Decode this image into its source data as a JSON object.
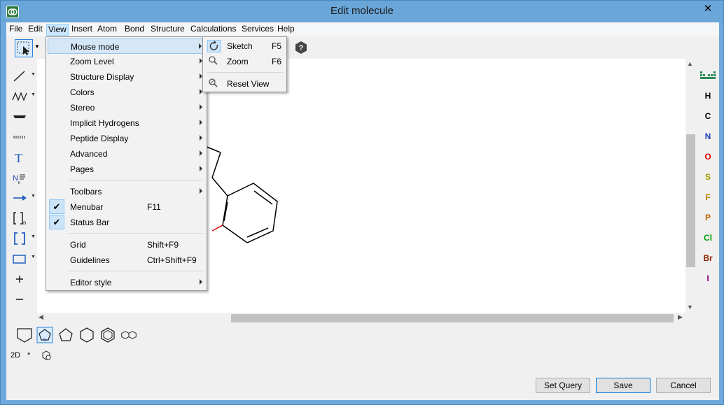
{
  "window": {
    "title": "Edit molecule",
    "close_glyph": "✕"
  },
  "menubar": [
    "File",
    "Edit",
    "View",
    "Insert",
    "Atom",
    "Bond",
    "Structure",
    "Calculations",
    "Services",
    "Help"
  ],
  "view_menu": {
    "items": [
      {
        "label": "Mouse mode",
        "submenu": true,
        "highlighted": true
      },
      {
        "label": "Zoom Level",
        "submenu": true
      },
      {
        "label": "Structure Display",
        "submenu": true
      },
      {
        "label": "Colors",
        "submenu": true
      },
      {
        "label": "Stereo",
        "submenu": true
      },
      {
        "label": "Implicit Hydrogens",
        "submenu": true
      },
      {
        "label": "Peptide Display",
        "submenu": true
      },
      {
        "label": "Advanced",
        "submenu": true
      },
      {
        "label": "Pages",
        "submenu": true
      },
      {
        "label": "Toolbars",
        "submenu": true
      },
      {
        "label": "Menubar",
        "shortcut": "F11",
        "checked": true
      },
      {
        "label": "Status Bar",
        "checked": true
      },
      {
        "label": "Grid",
        "shortcut": "Shift+F9"
      },
      {
        "label": "Guidelines",
        "shortcut": "Ctrl+Shift+F9"
      },
      {
        "label": "Editor style",
        "submenu": true
      }
    ]
  },
  "mouse_mode_menu": {
    "items": [
      {
        "label": "Sketch",
        "shortcut": "F5",
        "icon": "sketch-icon",
        "selected": true
      },
      {
        "label": "Zoom",
        "shortcut": "F6",
        "icon": "magnifier-icon"
      },
      {
        "label": "Reset View",
        "icon": "reset-view-icon"
      }
    ]
  },
  "elements": [
    {
      "symbol": "H",
      "color": "#000000"
    },
    {
      "symbol": "C",
      "color": "#000000"
    },
    {
      "symbol": "N",
      "color": "#1f3fb8"
    },
    {
      "symbol": "O",
      "color": "#e00000"
    },
    {
      "symbol": "S",
      "color": "#a0a000"
    },
    {
      "symbol": "F",
      "color": "#c08000"
    },
    {
      "symbol": "P",
      "color": "#c06000"
    },
    {
      "symbol": "Cl",
      "color": "#00a000"
    },
    {
      "symbol": "Br",
      "color": "#8b2500"
    },
    {
      "symbol": "I",
      "color": "#800080"
    }
  ],
  "modes": {
    "dim": "2D",
    "star": "*"
  },
  "buttons": {
    "set_query": "Set Query",
    "save": "Save",
    "cancel": "Cancel"
  },
  "colors": {
    "accent": "#0078d7",
    "titlebar": "#6aa6d8",
    "highlight": "#d5e6f7"
  }
}
